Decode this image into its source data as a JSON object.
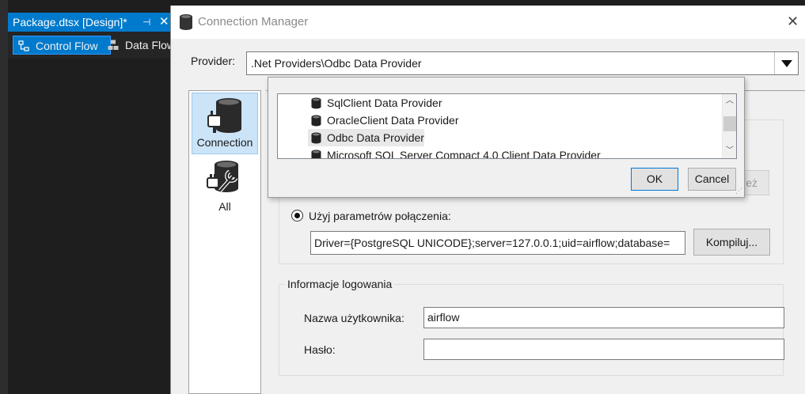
{
  "ide": {
    "doc_tab": "Package.dtsx [Design]*",
    "designer_tabs": [
      {
        "label": "Control Flow"
      },
      {
        "label": "Data Flow"
      }
    ]
  },
  "dialog": {
    "title": "Connection Manager",
    "provider_label": "Provider:",
    "provider_value": ".Net Providers\\Odbc Data Provider",
    "pages": [
      {
        "label": "Connection"
      },
      {
        "label": "All"
      }
    ],
    "disabled_button_partial": "eż",
    "radio_label": "Użyj parametrów połączenia:",
    "connection_string": "Driver={PostgreSQL UNICODE};server=127.0.0.1;uid=airflow;database=",
    "compile_button": "Kompiluj...",
    "login_group_title": "Informacje logowania",
    "username_label": "Nazwa użytkownika:",
    "username_value": "airflow",
    "password_label": "Hasło:",
    "password_value": ""
  },
  "provider_popup": {
    "items": [
      {
        "label": "SqlClient Data Provider"
      },
      {
        "label": "OracleClient Data Provider"
      },
      {
        "label": "Odbc Data Provider"
      },
      {
        "label": "Microsoft SQL Server Compact 4.0 Client Data Provider"
      }
    ],
    "ok": "OK",
    "cancel": "Cancel"
  }
}
